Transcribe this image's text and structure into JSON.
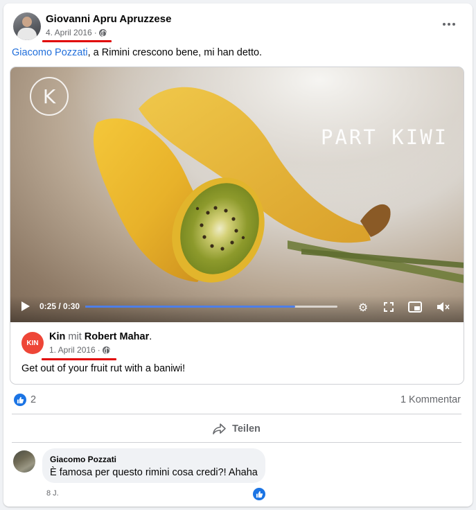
{
  "post": {
    "author_name": "Giovanni Apru Apruzzese",
    "date": "4. April 2016",
    "date_separator": "·",
    "visibility_icon": "globe-icon",
    "more_icon": "more-horizontal-icon",
    "tagged_name": "Giacomo Pozzati",
    "text_rest": ", a Rimini crescono bene, mi han detto."
  },
  "video": {
    "brand_mark": "K",
    "overlay_text": "PART KIWI",
    "time": "0:25 / 0:30",
    "progress_fraction": 0.8333,
    "icons": [
      "play-icon",
      "settings-icon",
      "fullscreen-icon",
      "picture-in-picture-icon",
      "mute-icon"
    ]
  },
  "shared": {
    "page_avatar_text": "KIN",
    "page_name": "Kin",
    "with_word": "mit",
    "with_name": "Robert Mahar",
    "period": ".",
    "date": "1. April 2016",
    "text": "Get out of your fruit rut with a baniwi!"
  },
  "reactions": {
    "likes_count": "2",
    "comments_label": "1 Kommentar",
    "like_icon": "thumbs-up-icon"
  },
  "actions": {
    "share_label": "Teilen",
    "share_icon": "share-arrow-icon"
  },
  "comment": {
    "author": "Giacomo Pozzati",
    "text": "È famosa per questo rimini cosa credi?! Ahaha",
    "time": "8 J."
  },
  "colors": {
    "link": "#216fdb",
    "like_blue": "#1b74e4",
    "annotation_red": "#e00000",
    "secondary_text": "#65676b"
  }
}
